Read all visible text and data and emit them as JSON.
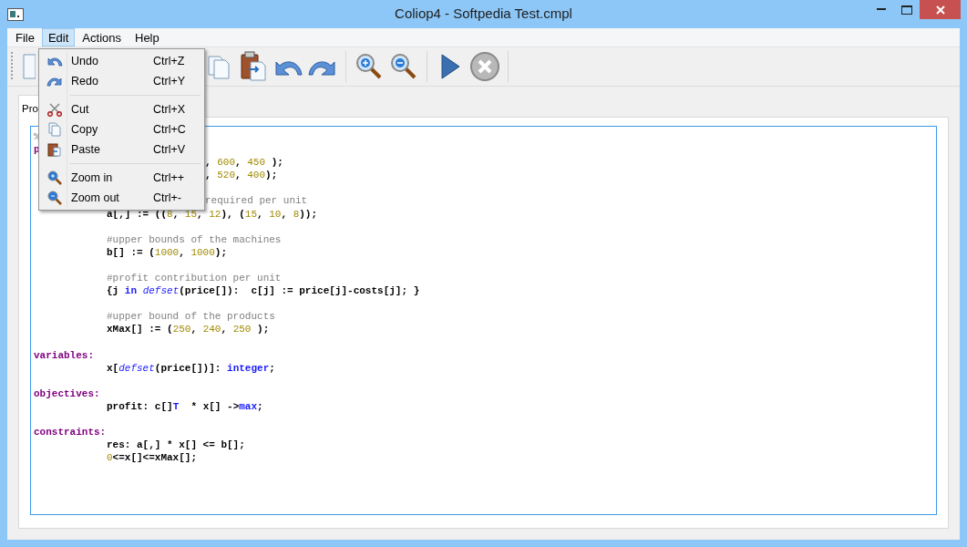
{
  "window": {
    "title": "Coliop4 - Softpedia Test.cmpl"
  },
  "menu_bar": [
    {
      "label": "File",
      "selected": false
    },
    {
      "label": "Edit",
      "selected": true
    },
    {
      "label": "Actions",
      "selected": false
    },
    {
      "label": "Help",
      "selected": false
    }
  ],
  "edit_menu": [
    {
      "kind": "item",
      "label": "Undo",
      "shortcut": "Ctrl+Z"
    },
    {
      "kind": "item",
      "label": "Redo",
      "shortcut": "Ctrl+Y"
    },
    {
      "kind": "separator"
    },
    {
      "kind": "item",
      "label": "Cut",
      "shortcut": "Ctrl+X"
    },
    {
      "kind": "item",
      "label": "Copy",
      "shortcut": "Ctrl+C"
    },
    {
      "kind": "item",
      "label": "Paste",
      "shortcut": "Ctrl+V"
    },
    {
      "kind": "separator"
    },
    {
      "kind": "item",
      "label": "Zoom in",
      "shortcut": "Ctrl++"
    },
    {
      "kind": "item",
      "label": "Zoom out",
      "shortcut": "Ctrl+-"
    }
  ],
  "tabs": [
    {
      "label": "Pro",
      "selected": true
    }
  ],
  "editor_lines": [
    {
      "kind": "full",
      "indent": false,
      "segments": [
        {
          "kind": "comment",
          "text": "%"
        }
      ]
    },
    {
      "kind": "full",
      "indent": false,
      "segments": [
        {
          "kind": "section",
          "text": "p"
        }
      ]
    },
    {
      "kind": "partial",
      "segments": [
        {
          "kind": "plain",
          "text": ", "
        },
        {
          "kind": "number",
          "text": "600"
        },
        {
          "kind": "plain",
          "text": ", "
        },
        {
          "kind": "number",
          "text": "450"
        },
        {
          "kind": "plain",
          "text": " );"
        }
      ]
    },
    {
      "kind": "partial",
      "segments": [
        {
          "kind": "plain",
          "text": ", "
        },
        {
          "kind": "number",
          "text": "520"
        },
        {
          "kind": "plain",
          "text": ", "
        },
        {
          "kind": "number",
          "text": "400"
        },
        {
          "kind": "plain",
          "text": ");"
        }
      ]
    },
    {
      "kind": "blank"
    },
    {
      "kind": "partial",
      "segments": [
        {
          "kind": "comment",
          "text": "required per unit"
        }
      ]
    },
    {
      "kind": "full",
      "indent": true,
      "segments": [
        {
          "kind": "plain",
          "text": "a[,] := (("
        },
        {
          "kind": "number",
          "text": "8"
        },
        {
          "kind": "plain",
          "text": ", "
        },
        {
          "kind": "number",
          "text": "15"
        },
        {
          "kind": "plain",
          "text": ", "
        },
        {
          "kind": "number",
          "text": "12"
        },
        {
          "kind": "plain",
          "text": "), ("
        },
        {
          "kind": "number",
          "text": "15"
        },
        {
          "kind": "plain",
          "text": ", "
        },
        {
          "kind": "number",
          "text": "10"
        },
        {
          "kind": "plain",
          "text": ", "
        },
        {
          "kind": "number",
          "text": "8"
        },
        {
          "kind": "plain",
          "text": "));"
        }
      ]
    },
    {
      "kind": "blank"
    },
    {
      "kind": "full",
      "indent": true,
      "segments": [
        {
          "kind": "comment",
          "text": "#upper bounds of the machines"
        }
      ]
    },
    {
      "kind": "full",
      "indent": true,
      "segments": [
        {
          "kind": "plain",
          "text": "b[] := ("
        },
        {
          "kind": "number",
          "text": "1000"
        },
        {
          "kind": "plain",
          "text": ", "
        },
        {
          "kind": "number",
          "text": "1000"
        },
        {
          "kind": "plain",
          "text": ");"
        }
      ]
    },
    {
      "kind": "blank"
    },
    {
      "kind": "full",
      "indent": true,
      "segments": [
        {
          "kind": "comment",
          "text": "#profit contribution per unit"
        }
      ]
    },
    {
      "kind": "full",
      "indent": true,
      "segments": [
        {
          "kind": "plain",
          "text": "{j "
        },
        {
          "kind": "keyword",
          "text": "in "
        },
        {
          "kind": "function",
          "text": "defset"
        },
        {
          "kind": "plain",
          "text": "(price[]):  c[j] := price[j]-costs[j]; }"
        }
      ]
    },
    {
      "kind": "blank"
    },
    {
      "kind": "full",
      "indent": true,
      "segments": [
        {
          "kind": "comment",
          "text": "#upper bound of the products"
        }
      ]
    },
    {
      "kind": "full",
      "indent": true,
      "segments": [
        {
          "kind": "plain",
          "text": "xMax[] := ("
        },
        {
          "kind": "number",
          "text": "250"
        },
        {
          "kind": "plain",
          "text": ", "
        },
        {
          "kind": "number",
          "text": "240"
        },
        {
          "kind": "plain",
          "text": ", "
        },
        {
          "kind": "number",
          "text": "250"
        },
        {
          "kind": "plain",
          "text": " );"
        }
      ]
    },
    {
      "kind": "blank"
    },
    {
      "kind": "full",
      "indent": false,
      "segments": [
        {
          "kind": "section",
          "text": "variables:"
        }
      ]
    },
    {
      "kind": "full",
      "indent": true,
      "segments": [
        {
          "kind": "plain",
          "text": "x["
        },
        {
          "kind": "function",
          "text": "defset"
        },
        {
          "kind": "plain",
          "text": "(price[])]: "
        },
        {
          "kind": "keyword",
          "text": "integer"
        },
        {
          "kind": "plain",
          "text": ";"
        }
      ]
    },
    {
      "kind": "blank"
    },
    {
      "kind": "full",
      "indent": false,
      "segments": [
        {
          "kind": "section",
          "text": "objectives:"
        }
      ]
    },
    {
      "kind": "full",
      "indent": true,
      "segments": [
        {
          "kind": "plain",
          "text": "profit: c[]"
        },
        {
          "kind": "keyword",
          "text": "T"
        },
        {
          "kind": "plain",
          "text": "  * x[] ->"
        },
        {
          "kind": "keyword",
          "text": "max"
        },
        {
          "kind": "plain",
          "text": ";"
        }
      ]
    },
    {
      "kind": "blank"
    },
    {
      "kind": "full",
      "indent": false,
      "segments": [
        {
          "kind": "section",
          "text": "constraints:"
        }
      ]
    },
    {
      "kind": "full",
      "indent": true,
      "segments": [
        {
          "kind": "plain",
          "text": "res: a[,] * x[] <= b[];"
        }
      ]
    },
    {
      "kind": "full",
      "indent": true,
      "segments": [
        {
          "kind": "number",
          "text": "0"
        },
        {
          "kind": "plain",
          "text": "<=x[]<=xMax[];"
        }
      ]
    }
  ]
}
